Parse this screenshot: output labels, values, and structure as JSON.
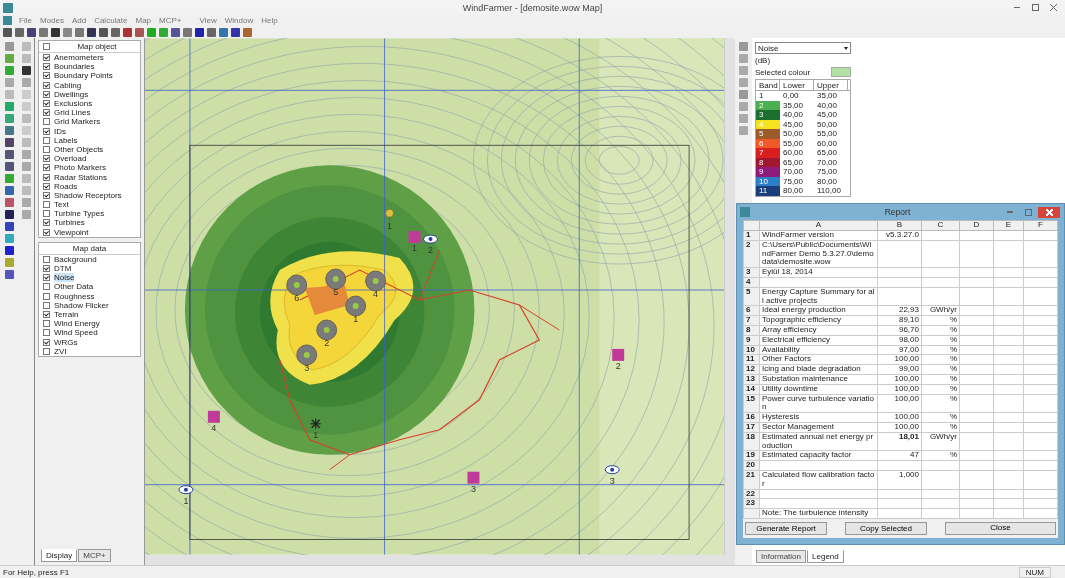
{
  "window": {
    "title": "WindFarmer - [demosite.wow Map]"
  },
  "menu": [
    "File",
    "Modes",
    "Add",
    "Calculate",
    "Map",
    "MCP+",
    "View",
    "Window",
    "Help"
  ],
  "map_object": {
    "header": "Map object",
    "checked": false,
    "items": [
      {
        "label": "Anemometers",
        "checked": true
      },
      {
        "label": "Boundaries",
        "checked": true
      },
      {
        "label": "Boundary Points",
        "checked": true
      },
      {
        "label": "Cabling",
        "checked": true
      },
      {
        "label": "Dwellings",
        "checked": true
      },
      {
        "label": "Exclusions",
        "checked": true
      },
      {
        "label": "Grid Lines",
        "checked": true
      },
      {
        "label": "Grid Markers",
        "checked": false
      },
      {
        "label": "IDs",
        "checked": true
      },
      {
        "label": "Labels",
        "checked": false
      },
      {
        "label": "Other Objects",
        "checked": false
      },
      {
        "label": "Overload",
        "checked": true
      },
      {
        "label": "Photo Markers",
        "checked": true
      },
      {
        "label": "Radar Stations",
        "checked": true
      },
      {
        "label": "Roads",
        "checked": true
      },
      {
        "label": "Shadow Receptors",
        "checked": true
      },
      {
        "label": "Text",
        "checked": false
      },
      {
        "label": "Turbine Types",
        "checked": false
      },
      {
        "label": "Turbines",
        "checked": true
      },
      {
        "label": "Viewpoint",
        "checked": true
      }
    ]
  },
  "map_data": {
    "header": "Map data",
    "items": [
      {
        "label": "Background",
        "checked": false,
        "selected": false
      },
      {
        "label": "DTM",
        "checked": true,
        "selected": false
      },
      {
        "label": "Noise",
        "checked": true,
        "selected": true
      },
      {
        "label": "Other Data",
        "checked": false,
        "selected": false
      },
      {
        "label": "Roughness",
        "checked": false,
        "selected": false
      },
      {
        "label": "Shadow Flicker",
        "checked": false,
        "selected": false
      },
      {
        "label": "Terrain",
        "checked": true,
        "selected": false
      },
      {
        "label": "Wind Energy",
        "checked": false,
        "selected": false
      },
      {
        "label": "Wind Speed",
        "checked": false,
        "selected": false
      },
      {
        "label": "WRGs",
        "checked": true,
        "selected": false
      },
      {
        "label": "ZVI",
        "checked": false,
        "selected": false
      }
    ]
  },
  "panel_tabs": [
    {
      "label": "Display",
      "selected": true
    },
    {
      "label": "MCP+",
      "selected": false
    }
  ],
  "map": {
    "markers": [
      {
        "kind": "turbine",
        "label": "6"
      },
      {
        "kind": "turbine",
        "label": "5"
      },
      {
        "kind": "turbine",
        "label": "4"
      },
      {
        "kind": "turbine",
        "label": "1"
      },
      {
        "kind": "turbine",
        "label": "2"
      },
      {
        "kind": "turbine",
        "label": "3"
      },
      {
        "kind": "anemometer",
        "label": "1"
      },
      {
        "kind": "photo",
        "label": "1"
      },
      {
        "kind": "photo",
        "label": "2"
      },
      {
        "kind": "photo",
        "label": "4"
      },
      {
        "kind": "photo",
        "label": "3"
      },
      {
        "kind": "viewpoint",
        "label": "2"
      },
      {
        "kind": "viewpoint",
        "label": "3"
      },
      {
        "kind": "viewpoint",
        "label": "1"
      },
      {
        "kind": "receptor",
        "label": "1"
      }
    ]
  },
  "legend": {
    "layer": "Noise",
    "unit": "(dB)",
    "selected_colour_label": "Selected colour",
    "columns": [
      "Band",
      "Lower",
      "Upper"
    ],
    "bands": [
      {
        "band": "1",
        "lower": "0,00",
        "upper": "35,00"
      },
      {
        "band": "2",
        "lower": "35,00",
        "upper": "40,00",
        "color": "#4caf50"
      },
      {
        "band": "3",
        "lower": "40,00",
        "upper": "45,00",
        "color": "#1b6e2e"
      },
      {
        "band": "4",
        "lower": "45,00",
        "upper": "50,00",
        "color": "#f5e320"
      },
      {
        "band": "5",
        "lower": "50,00",
        "upper": "55,00",
        "color": "#9b5b2a"
      },
      {
        "band": "6",
        "lower": "55,00",
        "upper": "60,00",
        "color": "#f05a28"
      },
      {
        "band": "7",
        "lower": "60,00",
        "upper": "65,00",
        "color": "#d81e1e"
      },
      {
        "band": "8",
        "lower": "65,00",
        "upper": "70,00",
        "color": "#a01830"
      },
      {
        "band": "9",
        "lower": "70,00",
        "upper": "75,00",
        "color": "#8e1a7a"
      },
      {
        "band": "10",
        "lower": "75,00",
        "upper": "80,00",
        "color": "#2f7fc8"
      },
      {
        "band": "11",
        "lower": "80,00",
        "upper": "110,00",
        "color": "#1a3e7a"
      }
    ]
  },
  "bottom_tabs": [
    {
      "label": "Information",
      "selected": false
    },
    {
      "label": "Legend",
      "selected": true
    }
  ],
  "report": {
    "title": "Report",
    "columns": [
      "A",
      "B",
      "C",
      "D",
      "E",
      "F"
    ],
    "rows": [
      {
        "n": "1",
        "a": "WindFarmer version",
        "b": "v5.3.27.0"
      },
      {
        "n": "2",
        "a": "C:\\Users\\Public\\Documents\\WindFarmer Demo 5.3.27.0\\demodata\\demosite.wow"
      },
      {
        "n": "3",
        "a": "Eylül 18, 2014"
      },
      {
        "n": "4"
      },
      {
        "n": "5",
        "a": "Energy Capture Summary  for all active projects"
      },
      {
        "n": "6",
        "a": "Ideal energy production",
        "b": "22,93",
        "c": "GWh/yr"
      },
      {
        "n": "7",
        "a": "Topographic efficiency",
        "b": "89,10",
        "c": "%"
      },
      {
        "n": "8",
        "a": "Array efficiency",
        "b": "96,70",
        "c": "%"
      },
      {
        "n": "9",
        "a": "Electrical efficiency",
        "b": "98,00",
        "c": "%"
      },
      {
        "n": "10",
        "a": "Availability",
        "b": "97,00",
        "c": "%"
      },
      {
        "n": "11",
        "a": "Other Factors",
        "b": "100,00",
        "c": "%"
      },
      {
        "n": "12",
        "a": "Icing and blade degradation",
        "b": "99,00",
        "c": "%"
      },
      {
        "n": "13",
        "a": "Substation maintenance",
        "b": "100,00",
        "c": "%"
      },
      {
        "n": "14",
        "a": "Utility downtime",
        "b": "100,00",
        "c": "%"
      },
      {
        "n": "15",
        "a": "Power curve turbulence variation",
        "b": "100,00",
        "c": "%"
      },
      {
        "n": "16",
        "a": "Hysteresis",
        "b": "100,00",
        "c": "%"
      },
      {
        "n": "17",
        "a": "Sector Management",
        "b": "100,00",
        "c": "%"
      },
      {
        "n": "18",
        "a": "Estimated annual net energy production",
        "b": "18,01",
        "c": "GWh/yr",
        "bold": true
      },
      {
        "n": "19",
        "a": "Estimated capacity factor",
        "b": "47",
        "c": "%"
      },
      {
        "n": "20"
      },
      {
        "n": "21",
        "a": "Calculated flow calibration factor",
        "b": "1,000"
      },
      {
        "n": "22"
      },
      {
        "n": "23"
      },
      {
        "a": "Note: The turbulence intensity"
      }
    ],
    "buttons": [
      "Generate Report",
      "Copy Selected",
      "Close"
    ]
  },
  "status_bar": {
    "help": "For Help, press F1",
    "indicator": "NUM"
  }
}
